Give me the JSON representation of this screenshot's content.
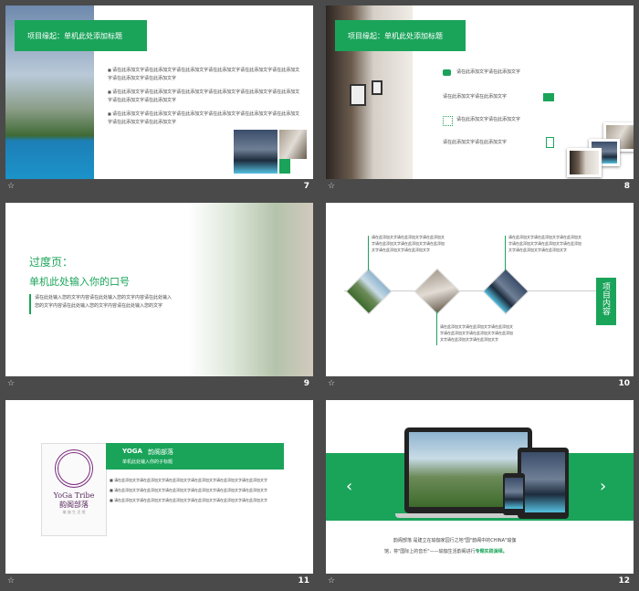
{
  "colors": {
    "accent": "#1aa45a",
    "background": "#4a4a4a"
  },
  "filler": {
    "long": "请在此添加文字请在此添加文字请在此添加文字请在此添加文字",
    "short": "请在此添加文字请在此添加文字"
  },
  "slide7": {
    "number": "7",
    "title": "项目缘起：单机此处添加标题",
    "bullets": [
      "请在此添加文字请在此添加文字请在此添加文字请在此添加文字请在此添加文字请在此添加文字请在此添加文字请在此添加文字",
      "请在此添加文字请在此添加文字请在此添加文字请在此添加文字请在此添加文字请在此添加文字请在此添加文字请在此添加文字",
      "请在此添加文字请在此添加文字请在此添加文字请在此添加文字请在此添加文字请在此添加文字请在此添加文字请在此添加文字"
    ]
  },
  "slide8": {
    "number": "8",
    "title": "项目缘起：单机此处添加标题",
    "items": [
      "请在此添加文字请在此添加文字",
      "请在此添加文字请在此添加文字",
      "请在此添加文字请在此添加文字",
      "请在此添加文字请在此添加文字"
    ],
    "icons": [
      "chat-icon",
      "card-icon",
      "grid-icon",
      "document-icon"
    ]
  },
  "slide9": {
    "number": "9",
    "heading": "过度页：",
    "subheading": "单机此处输入你的口号",
    "body": "请在此处输入您的文字内容请在此处输入您的文字内容请在此处输入您的文字内容请在此处输入您的文字内容请在此处输入您的文字"
  },
  "slide10": {
    "number": "10",
    "label": "项目内容",
    "text_top": "请在此添加文字请在此添加文字请在此添加文字请在此添加文字请在此添加文字请在此添加文字请在此添加文字请在此添加文字",
    "text_bottom": "请在此添加文字请在此添加文字请在此添加文字请在此添加文字请在此添加文字请在此添加文字请在此添加文字请在此添加文字"
  },
  "slide11": {
    "number": "11",
    "logo_text": "YoGa Tribe",
    "logo_cn": "韵阁部落",
    "logo_tag": "瑜 伽 生 活 馆",
    "title_prefix": "YOGA",
    "title": "韵阁部落",
    "subtitle": "单机此处输入你的子标题",
    "bullets": [
      "请在此添加文字请在此添加文字请在此添加文字请在此添加文字请在此添加文字请在此添加文字",
      "请在此添加文字请在此添加文字请在此添加文字请在此添加文字请在此添加文字请在此添加文字",
      "请在此添加文字请在此添加文字请在此添加文字请在此添加文字请在此添加文字请在此添加文字"
    ]
  },
  "slide12": {
    "number": "12",
    "caption1": "韵阁部落 是建立在瑜伽家园行之地\"国\"韵阁中的CHINA\"瑜伽",
    "caption2": "馆，将\"国际上的音乐\"——瑜伽生活韵阁进行",
    "caption_highlight": "专题实践演绎。"
  }
}
